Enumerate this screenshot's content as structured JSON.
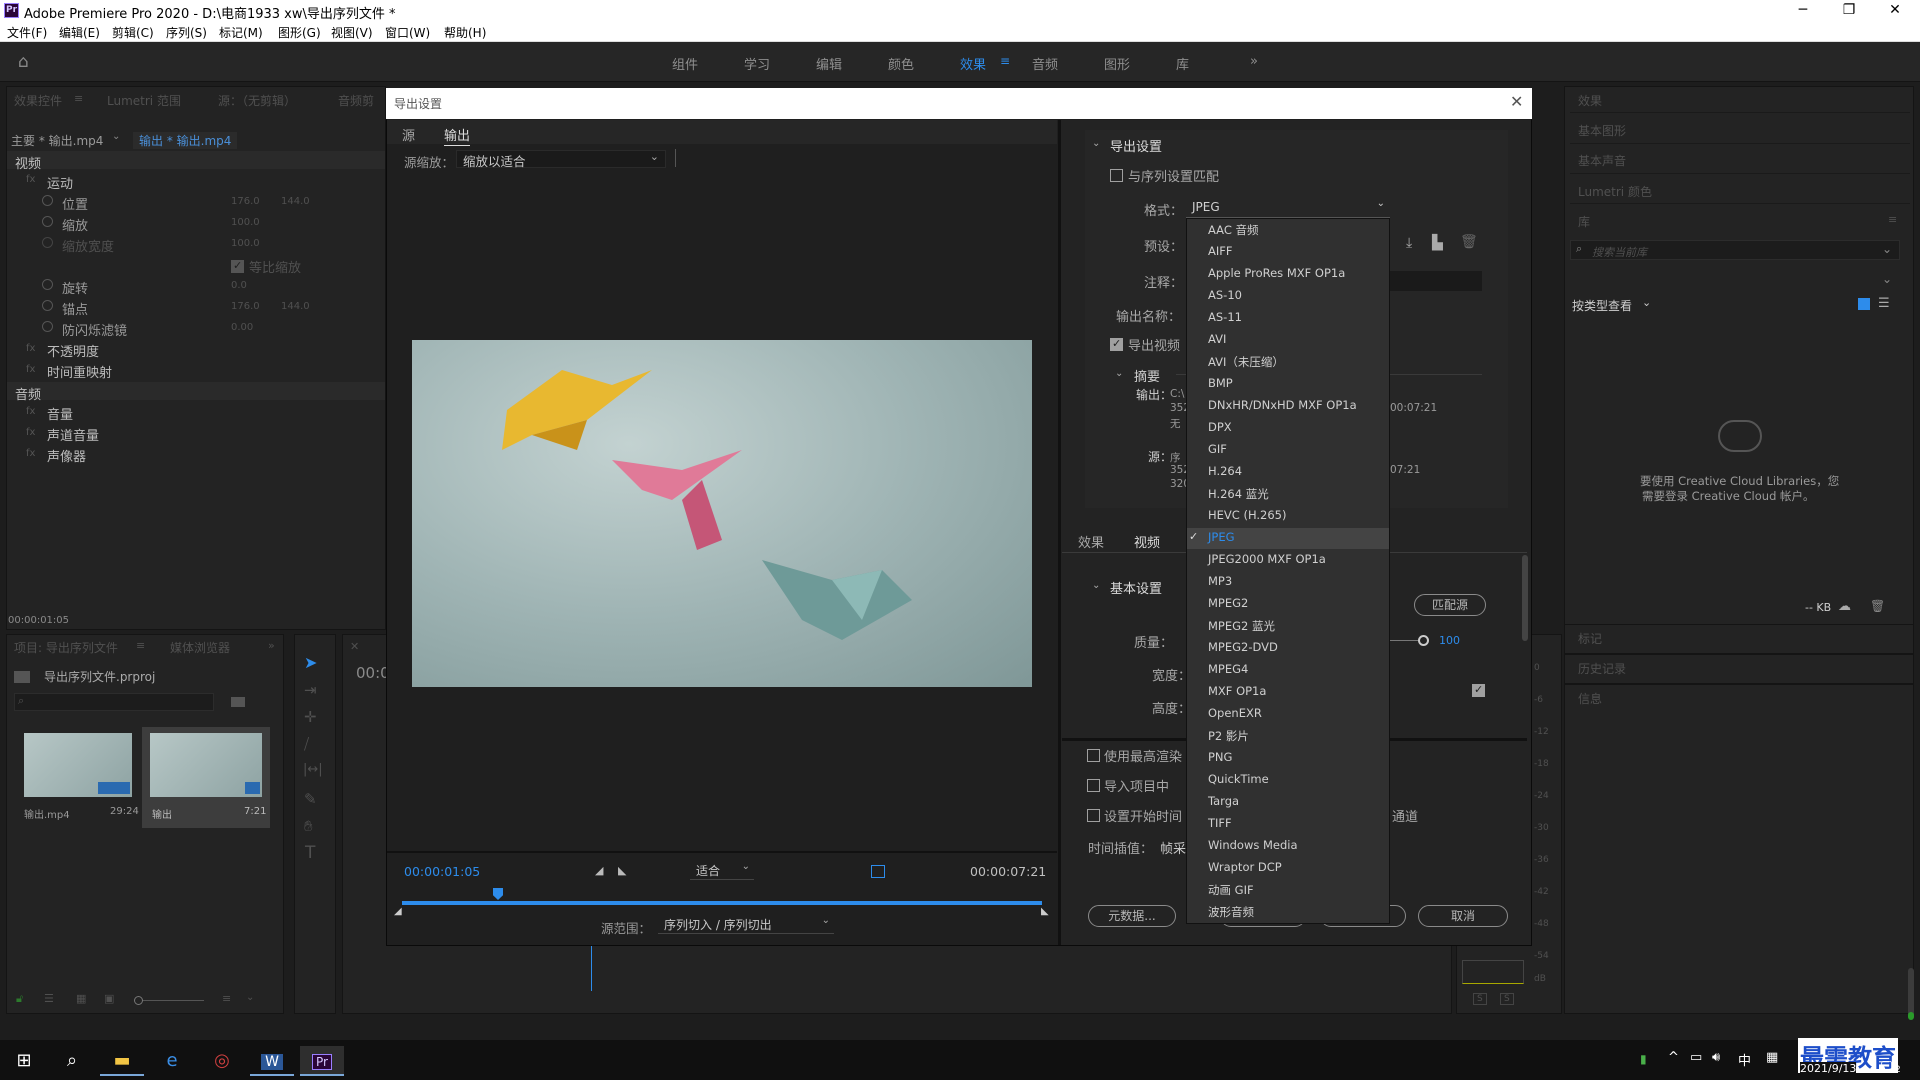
{
  "window": {
    "title": "Adobe Premiere Pro 2020 - D:\\电商1933 xw\\导出序列文件 *",
    "logo": "Pr"
  },
  "menu": [
    "文件(F)",
    "编辑(E)",
    "剪辑(C)",
    "序列(S)",
    "标记(M)",
    "图形(G)",
    "视图(V)",
    "窗口(W)",
    "帮助(H)"
  ],
  "workspaces": [
    "组件",
    "学习",
    "编辑",
    "颜色",
    "效果",
    "音频",
    "图形",
    "库"
  ],
  "workspace_active": "效果",
  "effect_controls": {
    "tabs": [
      "效果控件",
      "Lumetri 范围",
      "源：（无剪辑）",
      "音频剪"
    ],
    "clip_master": "主要 * 输出.mp4",
    "clip_seq": "输出 * 输出.mp4",
    "video_header": "视频",
    "rows": [
      {
        "label": "运动",
        "v1": "",
        "v2": ""
      },
      {
        "label": "位置",
        "v1": "176.0",
        "v2": "144.0"
      },
      {
        "label": "缩放",
        "v1": "100.0",
        "v2": ""
      },
      {
        "label": "缩放宽度",
        "v1": "100.0",
        "v2": ""
      },
      {
        "label": "等比缩放",
        "v1": "",
        "v2": ""
      },
      {
        "label": "旋转",
        "v1": "0.0",
        "v2": ""
      },
      {
        "label": "锚点",
        "v1": "176.0",
        "v2": "144.0"
      },
      {
        "label": "防闪烁滤镜",
        "v1": "0.00",
        "v2": ""
      },
      {
        "label": "不透明度",
        "v1": "",
        "v2": ""
      },
      {
        "label": "时间重映射",
        "v1": "",
        "v2": ""
      }
    ],
    "audio_header": "音频",
    "audio_rows": [
      "音量",
      "声道音量",
      "声像器"
    ],
    "timecode": "00:00:01:05"
  },
  "project": {
    "tabs": [
      "项目: 导出序列文件",
      "媒体浏览器"
    ],
    "file": "导出序列文件.prproj",
    "items": [
      {
        "name": "输出.mp4",
        "duration": "29:24"
      },
      {
        "name": "输出",
        "duration": "7:21"
      }
    ]
  },
  "timeline": {
    "timecode": "00:0"
  },
  "right_panels": {
    "effects": "效果",
    "essential_graphics": "基本图形",
    "essential_sound": "基本声音",
    "lumetri": "Lumetri 颜色",
    "libraries": "库",
    "search_placeholder": "搜索当前库",
    "view_by": "按类型查看",
    "cc_msg_1": "要使用 Creative Cloud Libraries，您",
    "cc_msg_2": "需要登录 Creative Cloud 帐户。",
    "kb": "-- KB",
    "markers": "标记",
    "history": "历史记录",
    "info": "信息"
  },
  "meter_labels": [
    "0",
    "-6",
    "-12",
    "-18",
    "-24",
    "-30",
    "-36",
    "-42",
    "-48",
    "-54",
    "dB"
  ],
  "meter_bottom": [
    "S",
    "S"
  ],
  "dialog": {
    "title": "导出设置",
    "tab_source": "源",
    "tab_output": "输出",
    "source_scaling_label": "源缩放：",
    "source_scaling_value": "缩放以适合",
    "timecode_current": "00:00:01:05",
    "timecode_total": "00:00:07:21",
    "fit_value": "适合",
    "source_range_label": "源范围：",
    "source_range_value": "序列切入 / 序列切出",
    "export_settings_header": "导出设置",
    "match_sequence": "与序列设置匹配",
    "format_label": "格式：",
    "format_value": "JPEG",
    "preset_label": "预设：",
    "comments_label": "注释：",
    "output_name_label": "输出名称：",
    "export_video": "导出视频",
    "summary_header": "摘要",
    "output_label": "输出：",
    "output_l1": "C:\\",
    "output_l2": "352",
    "output_l3": "无",
    "output_time": "00:07:21",
    "source_label": "源：",
    "source_l1": "序",
    "source_l2": "352",
    "source_l3": "320",
    "source_time": "07:21",
    "settings_tabs": [
      "效果",
      "视频"
    ],
    "basic_settings": "基本设置",
    "match_source": "匹配源",
    "quality_label": "质量：",
    "quality_value": "100",
    "width_label": "宽度：",
    "height_label": "高度：",
    "use_max_render": "使用最高渲染",
    "import_into_project": "导入项目中",
    "set_start_tc": "设置开始时间",
    "channel_text": "通道",
    "time_interp_label": "时间插值：",
    "time_interp_value": "帧采",
    "metadata_btn": "元数据...",
    "cancel_btn": "取消"
  },
  "format_dropdown": {
    "selected": "JPEG",
    "options": [
      "AAC 音频",
      "AIFF",
      "Apple ProRes MXF OP1a",
      "AS-10",
      "AS-11",
      "AVI",
      "AVI（未压缩）",
      "BMP",
      "DNxHR/DNxHD MXF OP1a",
      "DPX",
      "GIF",
      "H.264",
      "H.264 蓝光",
      "HEVC (H.265)",
      "JPEG",
      "JPEG2000 MXF OP1a",
      "MP3",
      "MPEG2",
      "MPEG2 蓝光",
      "MPEG2-DVD",
      "MPEG4",
      "MXF OP1a",
      "OpenEXR",
      "P2 影片",
      "PNG",
      "QuickTime",
      "Targa",
      "TIFF",
      "Windows Media",
      "Wraptor DCP",
      "动画 GIF",
      "波形音频"
    ]
  },
  "taskbar": {
    "ime": "中",
    "date": "2021/9/13",
    "watermark": "最需教育",
    "notif_count": "2"
  },
  "colors": {
    "accent": "#2d8ceb",
    "preview_bg": "#8fa5a5"
  }
}
